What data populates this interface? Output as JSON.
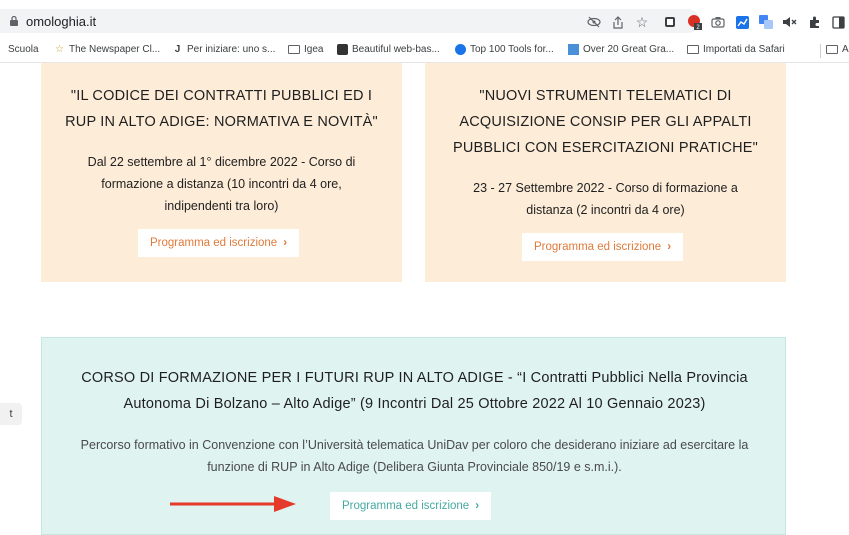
{
  "browser": {
    "url": "omologhia.it",
    "bookmarks": [
      {
        "label": "Scuola"
      },
      {
        "label": "The Newspaper Cl..."
      },
      {
        "label": "Per iniziare: uno s..."
      },
      {
        "label": "Igea"
      },
      {
        "label": "Beautiful web-bas..."
      },
      {
        "label": "Top 100 Tools for..."
      },
      {
        "label": "Over 20 Great Gra..."
      },
      {
        "label": "Importati da Safari"
      },
      {
        "label": "A"
      }
    ],
    "extension_badge": "2"
  },
  "cards": {
    "rup_codice": {
      "title": "\"IL CODICE DEI CONTRATTI PUBBLICI ED I RUP IN ALTO ADIGE: NORMATIVA E NOVITÀ\"",
      "description": "Dal 22 settembre al 1° dicembre 2022 - Corso di formazione a distanza (10 incontri da 4 ore, indipendenti tra loro)",
      "button": "Programma ed iscrizione"
    },
    "consip": {
      "title": "\"NUOVI STRUMENTI TELEMATICI DI ACQUISIZIONE CONSIP PER GLI APPALTI PUBBLICI CON ESERCITAZIONI PRATICHE\"",
      "description": "23 - 27 Settembre 2022 - Corso di formazione a distanza (2 incontri da 4 ore)",
      "button": "Programma ed iscrizione"
    },
    "futuri_rup": {
      "title": "CORSO DI FORMAZIONE PER I FUTURI RUP IN ALTO ADIGE - “I Contratti Pubblici Nella Provincia Autonoma Di Bolzano – Alto Adige” (9 Incontri Dal 25 Ottobre 2022 Al 10 Gennaio 2023)",
      "description": "Percorso formativo in Convenzione con l’Università telematica UniDav per coloro che desiderano iniziare ad esercitare la funzione di RUP in Alto Adige (Delibera Giunta Provinciale 850/19 e s.m.i.).",
      "button": "Programma ed iscrizione"
    }
  },
  "side_tab": "t",
  "colors": {
    "peach_card": "#fdecd8",
    "mint_card": "#dff3f1",
    "orange_link": "#e07a3b",
    "teal_link": "#46a9a1",
    "arrow_red": "#e53a2b"
  }
}
